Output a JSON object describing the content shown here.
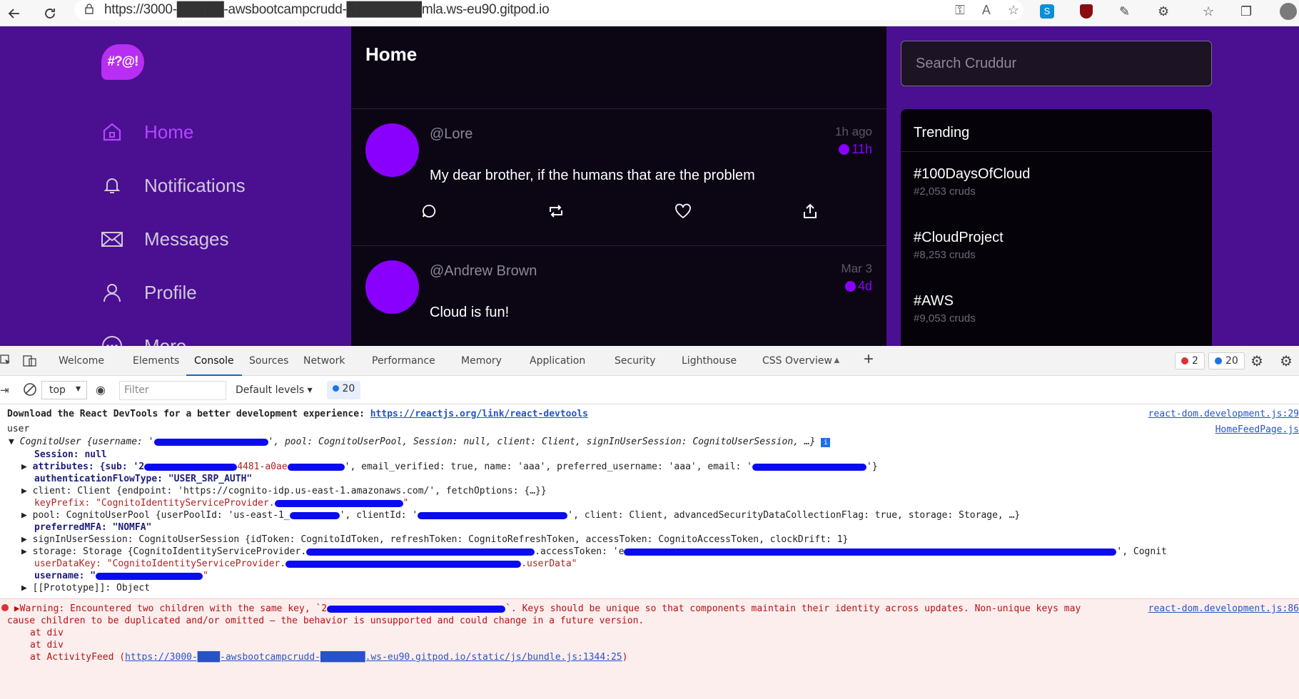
{
  "browser": {
    "url": "https://3000-█████-awsbootcampcrudd-████████mla.ws-eu90.gitpod.io"
  },
  "app": {
    "logo_text": "#?@!",
    "nav": [
      {
        "label": "Home",
        "icon": "home-icon",
        "active": true
      },
      {
        "label": "Notifications",
        "icon": "bell-icon"
      },
      {
        "label": "Messages",
        "icon": "envelope-icon"
      },
      {
        "label": "Profile",
        "icon": "user-icon"
      },
      {
        "label": "More",
        "icon": "more-icon"
      }
    ],
    "feed_title": "Home",
    "activities": [
      {
        "handle": "@Lore",
        "ago": "1h ago",
        "expires": "11h",
        "message": "My dear brother, if the humans that are the problem"
      },
      {
        "handle": "@Andrew Brown",
        "ago": "Mar 3",
        "expires": "4d",
        "message": "Cloud is fun!"
      }
    ],
    "search_placeholder": "Search Cruddur",
    "trending_title": "Trending",
    "trending": [
      {
        "tag": "#100DaysOfCloud",
        "count": "#2,053 cruds"
      },
      {
        "tag": "#CloudProject",
        "count": "#8,253 cruds"
      },
      {
        "tag": "#AWS",
        "count": "#9,053 cruds"
      }
    ],
    "colors": {
      "background": "#4b0f91",
      "accent": "#8a00ff",
      "feed_bg": "#0b0514"
    }
  },
  "devtools": {
    "tabs": [
      "Welcome",
      "Elements",
      "Console",
      "Sources",
      "Network",
      "Performance",
      "Memory",
      "Application",
      "Security",
      "Lighthouse",
      "CSS Overview"
    ],
    "active_tab": "Console",
    "errors_count": "2",
    "messages_count": "20",
    "context": "top",
    "filter_placeholder": "Filter",
    "levels": "Default levels",
    "issues_count": "20"
  },
  "console": {
    "react_msg": "Download the React DevTools for a better development experience: ",
    "react_link": "https://reactjs.org/link/react-devtools",
    "react_src": "react-dom.development.js:29",
    "user_label": "user",
    "user_src": "HomeFeedPage.js",
    "cognito_prefix": "CognitoUser {username: '",
    "cognito_suffix": "', pool: CognitoUserPool, Session: null, client: Client, signInUserSession: CognitoUserSession, …}",
    "session": "Session: null",
    "attributes_a": "attributes: {sub: '2",
    "attributes_b": "4481-a0ae",
    "attributes_c": "', email_verified: true, name: 'aaa', preferred_username: 'aaa', email: '",
    "attributes_d": "'}",
    "auth_flow": "authenticationFlowType: \"USER_SRP_AUTH\"",
    "client": "client: Client {endpoint: 'https://cognito-idp.us-east-1.amazonaws.com/', fetchOptions: {…}}",
    "key_prefix": "keyPrefix: \"CognitoIdentityServiceProvider.",
    "key_prefix_end": "\"",
    "pool_a": "pool: CognitoUserPool {userPoolId: 'us-east-1_",
    "pool_b": "', clientId: '",
    "pool_c": "', client: Client, advancedSecurityDataCollectionFlag: true, storage: Storage, …}",
    "preferred_mfa": "preferredMFA: \"NOMFA\"",
    "sign_in_session": "signInUserSession: CognitoUserSession {idToken: CognitoIdToken, refreshToken: CognitoRefreshToken, accessToken: CognitoAccessToken, clockDrift: 1}",
    "storage_a": "storage: Storage {CognitoIdentityServiceProvider.",
    "storage_b": ".accessToken: 'e",
    "storage_c": "', Cognit",
    "user_data_key_a": "userDataKey: \"CognitoIdentityServiceProvider.",
    "user_data_key_b": ".userData\"",
    "username": "username: \"",
    "username_end": "\"",
    "prototype": "[[Prototype]]: Object",
    "warning_a": "Warning: Encountered two children with the same key, `2",
    "warning_b": "`. Keys should be unique so that components maintain their identity across updates. Non-unique keys may",
    "warning_c": "cause children to be duplicated and/or omitted — the behavior is unsupported and could change in a future version.",
    "warning_src": "react-dom.development.js:86",
    "at_div": "at div",
    "at_feed_a": "at ActivityFeed (",
    "at_feed_link": "https://3000-████-awsbootcampcrudd-████████.ws-eu90.gitpod.io/static/js/bundle.js:1344:25",
    "at_feed_b": ")"
  }
}
